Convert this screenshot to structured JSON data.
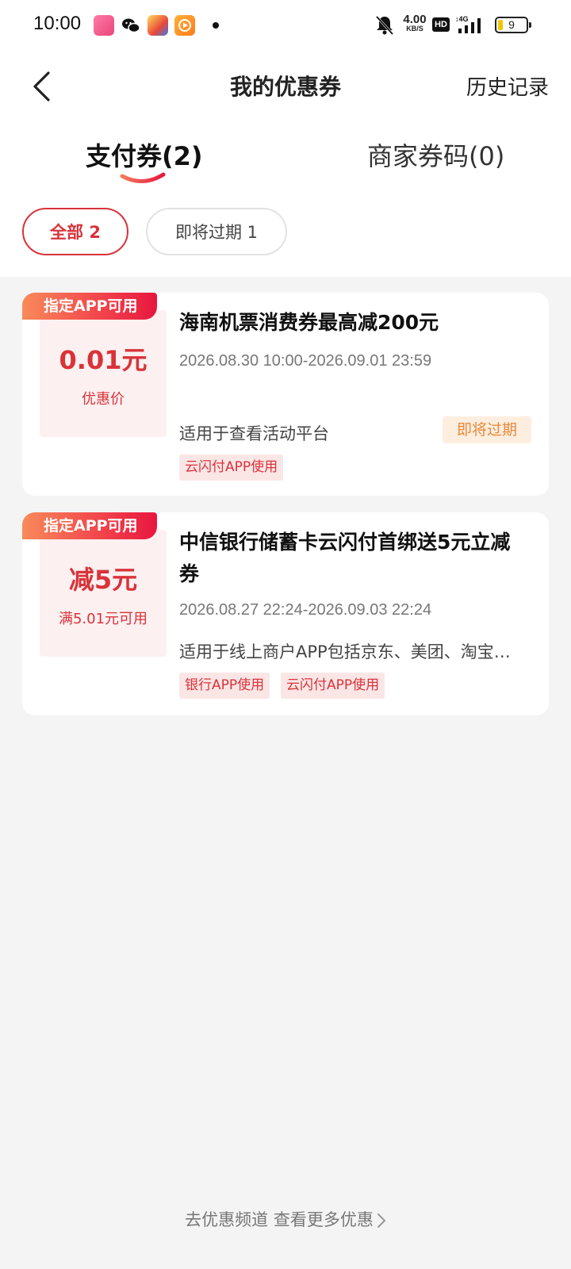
{
  "status_bar": {
    "time": "10:00",
    "speed_value": "4.00",
    "speed_unit": "KB/S",
    "hd": "HD",
    "network": "4G",
    "battery": "9"
  },
  "nav": {
    "title": "我的优惠券",
    "history": "历史记录"
  },
  "tabs": [
    {
      "label": "支付券(2)",
      "active": true
    },
    {
      "label": "商家券码(0)",
      "active": false
    }
  ],
  "filters": [
    {
      "label": "全部 2",
      "active": true
    },
    {
      "label": "即将过期 1",
      "active": false
    }
  ],
  "coupons": [
    {
      "tag": "指定APP可用",
      "value": "0.01元",
      "value_sub": "优惠价",
      "title": "海南机票消费券最高减200元",
      "date": "2026.08.30 10:00-2026.09.01 23:59",
      "desc": "适用于查看活动平台",
      "expire_badge": "即将过期",
      "channels": [
        "云闪付APP使用"
      ]
    },
    {
      "tag": "指定APP可用",
      "value": "减5元",
      "value_sub": "满5.01元可用",
      "title": "中信银行储蓄卡云闪付首绑送5元立减券",
      "date": "2026.08.27 22:24-2026.09.03 22:24",
      "desc": "适用于线上商户APP包括京东、美团、淘宝…",
      "channels": [
        "银行APP使用",
        "云闪付APP使用"
      ]
    }
  ],
  "footer": {
    "link": "去优惠频道 查看更多优惠"
  },
  "colors": {
    "accent": "#d9333a",
    "expire": "#e8893a",
    "background": "#f4f4f4"
  }
}
